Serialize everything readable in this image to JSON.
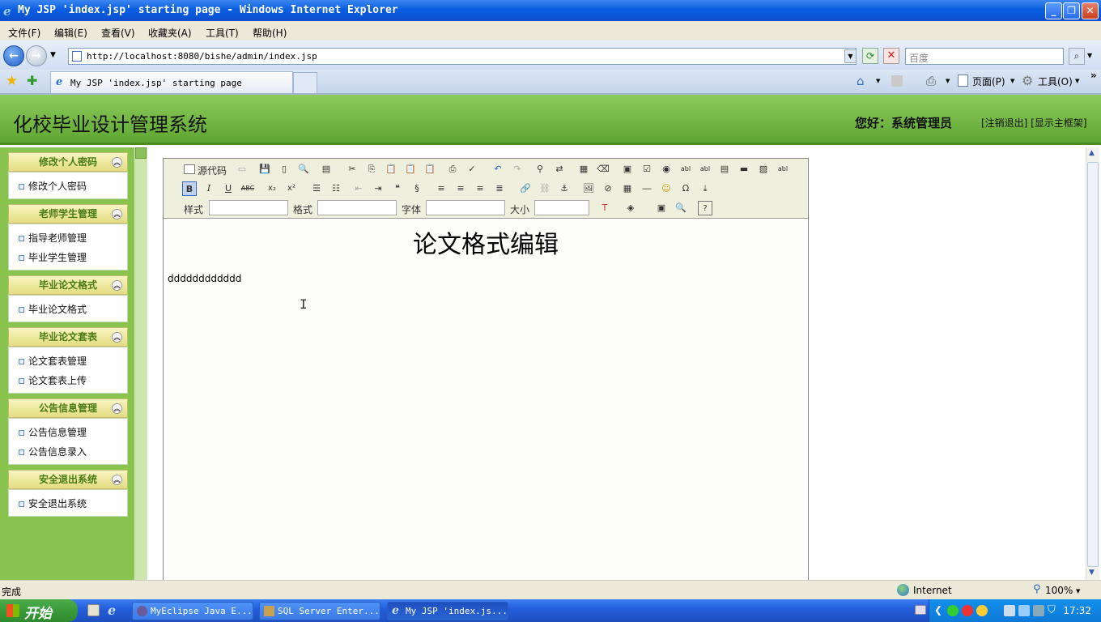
{
  "window": {
    "title": "My JSP 'index.jsp' starting page - Windows Internet Explorer",
    "controls": {
      "minimize": "_",
      "maximize": "❐",
      "close": "✕"
    }
  },
  "menu": [
    "文件(F)",
    "编辑(E)",
    "查看(V)",
    "收藏夹(A)",
    "工具(T)",
    "帮助(H)"
  ],
  "address": {
    "url": "http://localhost:8080/bishe/admin/index.jsp"
  },
  "search": {
    "placeholder": "百度"
  },
  "tab": {
    "label": "My JSP 'index.jsp' starting page"
  },
  "commandbar": {
    "page": "页面(P)",
    "tools": "工具(O)"
  },
  "header": {
    "system_name": "化校毕业设计管理系统",
    "greeting": "您好：系统管理员",
    "links": "[注销退出] [显示主框架]"
  },
  "sidebar": {
    "groups": [
      {
        "title": "修改个人密码",
        "items": [
          "修改个人密码"
        ]
      },
      {
        "title": "老师学生管理",
        "items": [
          "指导老师管理",
          "毕业学生管理"
        ]
      },
      {
        "title": "毕业论文格式",
        "items": [
          "毕业论文格式"
        ]
      },
      {
        "title": "毕业论文套表",
        "items": [
          "论文套表管理",
          "论文套表上传"
        ]
      },
      {
        "title": "公告信息管理",
        "items": [
          "公告信息管理",
          "公告信息录入"
        ]
      },
      {
        "title": "安全退出系统",
        "items": [
          "安全退出系统"
        ]
      }
    ]
  },
  "editor": {
    "source_button": "源代码",
    "style_label": "样式",
    "format_label": "格式",
    "font_label": "字体",
    "size_label": "大小",
    "doc_title": "论文格式编辑",
    "doc_text": "dddddddddddd"
  },
  "status": {
    "left": "完成",
    "zone": "Internet",
    "zoom": "100%"
  },
  "taskbar": {
    "start": "开始",
    "buttons": [
      "MyEclipse Java E...",
      "SQL Server Enter...",
      "My JSP 'index.js..."
    ],
    "clock": "17:32"
  }
}
